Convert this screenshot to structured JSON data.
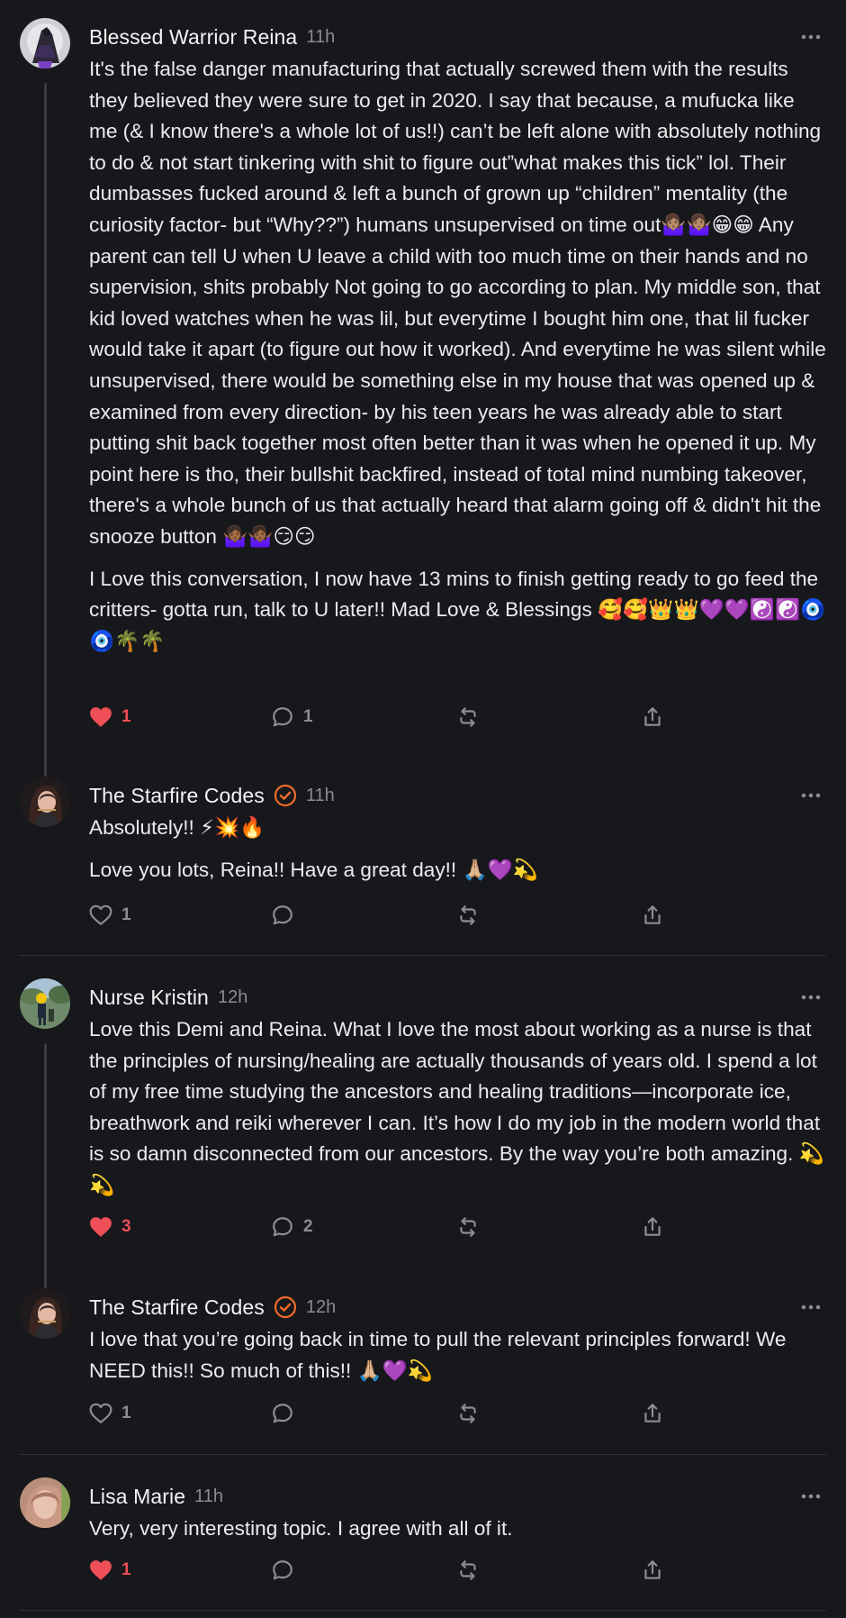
{
  "icons": {
    "more": "more-horizontal-icon",
    "like": "heart-icon",
    "reply": "comment-bubble-icon",
    "repost": "repost-icon",
    "share": "share-icon",
    "verified": "verified-badge-icon"
  },
  "colors": {
    "background": "#17181b",
    "like_active": "#ef4f57",
    "verified_accent": "#f26b2a",
    "muted": "#8b8c92"
  },
  "comments": [
    {
      "author": "Blessed Warrior Reina",
      "time": "11h",
      "verified": false,
      "paragraphs": [
        "It's the false danger manufacturing that actually screwed them with the results they believed they were sure to get in 2020. I say that because, a mufucka like me (& I know there's a whole lot of us!!) can’t be left alone with absolutely nothing to do & not start tinkering with shit to figure out”what makes this tick” lol. Their dumbasses fucked around & left a bunch of grown up “children” mentality (the curiosity factor- but “Why??”) humans unsupervised on time out🤷🏽‍♀️🤷🏽‍♀️😁😁 Any parent can tell U when U leave a child with too much time on their hands and no supervision, shits probably Not going to go according to plan. My middle son, that kid loved watches when he was lil, but everytime I bought him one, that lil fucker would take it apart (to figure out how it worked). And everytime he was silent while unsupervised, there would be something else in my house that was opened up & examined from every direction- by his teen years he was already able to start putting shit back together most often better than it was when he opened it up. My point here is tho, their bullshit backfired, instead of total mind numbing takeover, there's a whole bunch of us that actually heard that alarm going off & didn't hit the snooze button 🤷🏾‍♀️🤷🏾‍♀️😏😏",
        "I Love this conversation, I now have 13 mins to finish getting ready to go feed the critters- gotta run, talk to U later!! Mad Love & Blessings 🥰🥰👑👑💜💜☯️☯️🧿🧿🌴🌴"
      ],
      "likes": "1",
      "liked": true,
      "replies": "1"
    },
    {
      "author": "The Starfire Codes",
      "time": "11h",
      "verified": true,
      "paragraphs": [
        "Absolutely!! ⚡💥🔥",
        "Love you lots, Reina!! Have a great day!! 🙏🏼💜💫"
      ],
      "likes": "1",
      "liked": false,
      "replies": ""
    },
    {
      "author": "Nurse Kristin",
      "time": "12h",
      "verified": false,
      "paragraphs": [
        "Love this Demi and Reina. What I love the most about working as a nurse is that the principles of nursing/healing are actually thousands of years old. I spend a lot of my free time studying the ancestors and healing traditions—incorporate ice, breathwork and reiki wherever I can. It’s how I do my job in the modern world that is so damn disconnected from our ancestors. By the way you’re both amazing. 💫💫"
      ],
      "likes": "3",
      "liked": true,
      "replies": "2"
    },
    {
      "author": "The Starfire Codes",
      "time": "12h",
      "verified": true,
      "paragraphs": [
        "I love that you’re going back in time to pull the relevant principles forward! We NEED this!! So much of this!! 🙏🏼💜💫"
      ],
      "likes": "1",
      "liked": false,
      "replies": ""
    },
    {
      "author": "Lisa Marie",
      "time": "11h",
      "verified": false,
      "paragraphs": [
        "Very, very interesting topic. I agree with all of it."
      ],
      "likes": "1",
      "liked": true,
      "replies": ""
    }
  ]
}
